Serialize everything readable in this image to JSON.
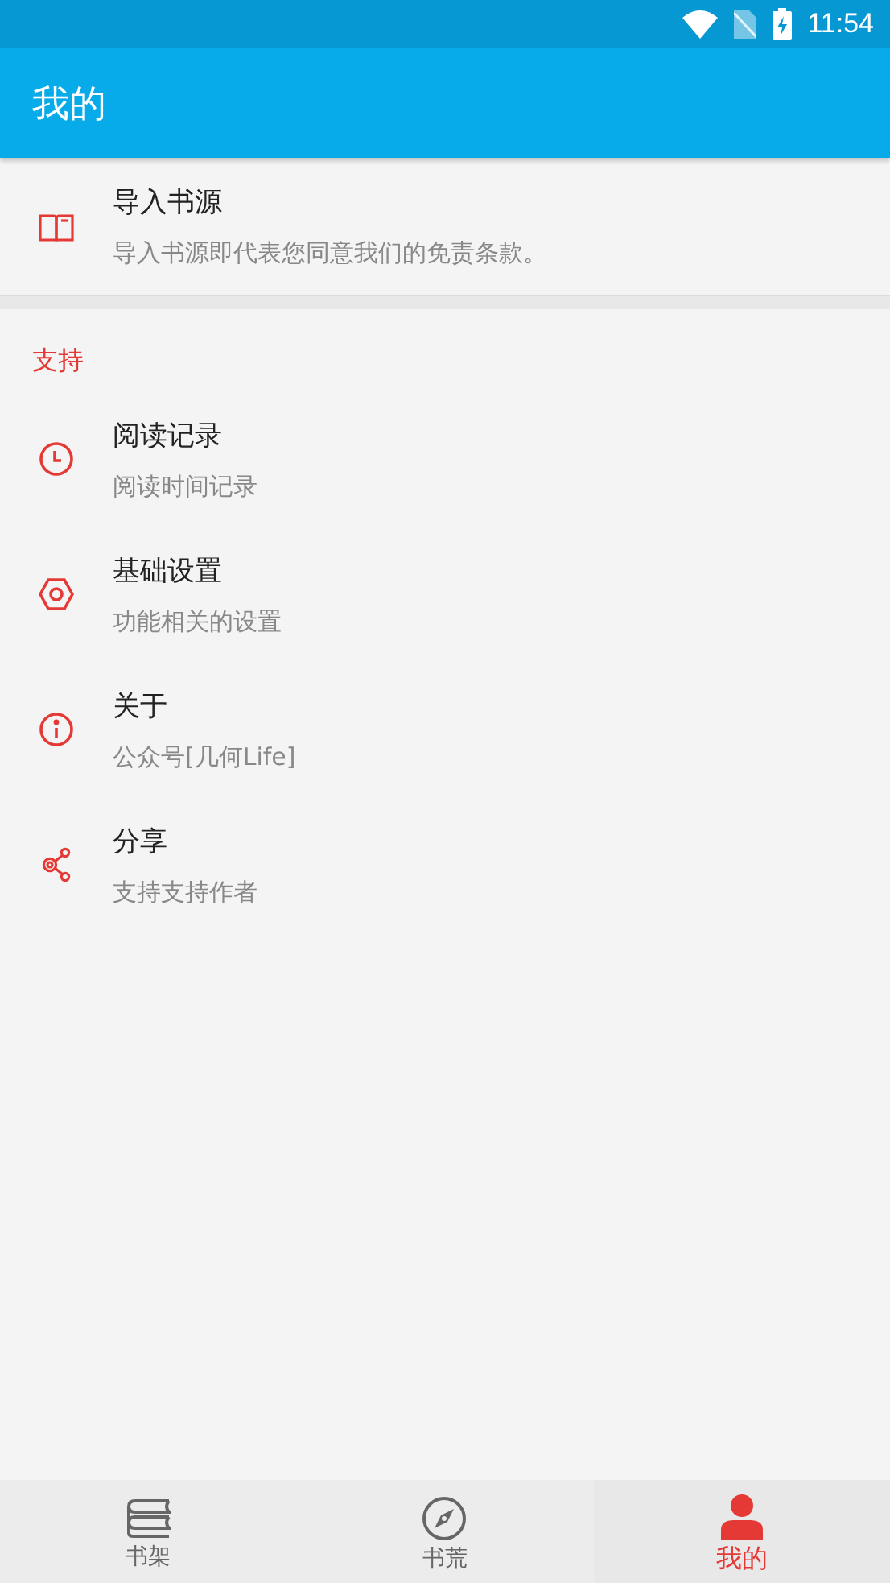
{
  "status_bar": {
    "time": "11:54"
  },
  "app_bar": {
    "title": "我的"
  },
  "import_item": {
    "kind": "book",
    "title": "导入书源",
    "subtitle": "导入书源即代表您同意我们的免责条款。"
  },
  "section": {
    "title": "支持",
    "items": [
      {
        "kind": "clock",
        "title": "阅读记录",
        "subtitle": "阅读时间记录"
      },
      {
        "kind": "settings",
        "title": "基础设置",
        "subtitle": "功能相关的设置"
      },
      {
        "kind": "info",
        "title": "关于",
        "subtitle": "公众号[几何Life]"
      },
      {
        "kind": "share",
        "title": "分享",
        "subtitle": "支持支持作者"
      }
    ]
  },
  "bottom_nav": [
    {
      "kind": "shelf",
      "label": "书架",
      "selected": false
    },
    {
      "kind": "compass",
      "label": "书荒",
      "selected": false
    },
    {
      "kind": "person",
      "label": "我的",
      "selected": true
    }
  ]
}
